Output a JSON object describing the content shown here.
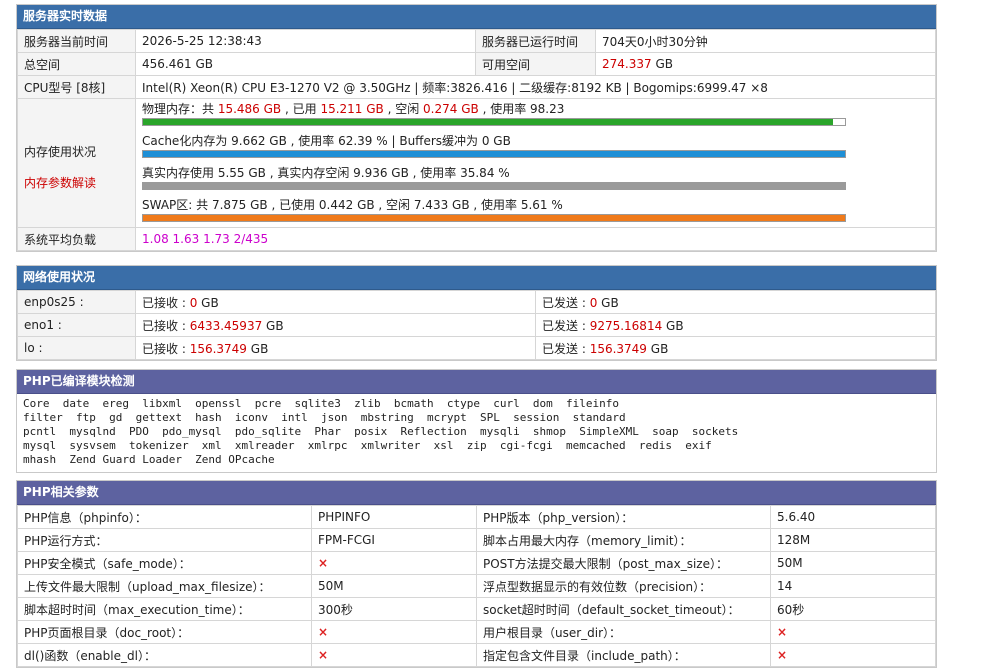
{
  "server": {
    "title": "服务器实时数据",
    "rows": [
      {
        "l1": "服务器当前时间",
        "v1": "2026-5-25 12:38:43",
        "l2": "服务器已运行时间",
        "v2": "704天0小时30分钟"
      },
      {
        "l1": "总空间",
        "v1": "456.461 GB",
        "l2": "可用空间",
        "v2_num": "274.337",
        "v2_unit": " GB"
      }
    ],
    "cpu_label": "CPU型号 [8核]",
    "cpu_value": "Intel(R) Xeon(R) CPU E3-1270 V2 @ 3.50GHz | 频率:3826.416 | 二级缓存:8192 KB | Bogomips:6999.47 ×8",
    "mem_label": "内存使用状况",
    "mem_link": "内存参数解读",
    "mem": {
      "physical": {
        "p1": "物理内存：共 ",
        "total": "15.486 GB",
        "p2": " , 已用 ",
        "used": "15.211 GB",
        "p3": " , 空闲 ",
        "free": "0.274 GB",
        "p4": " , 使用率 98.23",
        "percent": 98.23,
        "color": "#2aa52a"
      },
      "cache": {
        "text": "Cache化内存为 9.662 GB , 使用率 62.39 % | Buffers缓冲为 0 GB",
        "percent": 100,
        "color": "#1e8fd6"
      },
      "real": {
        "text": "真实内存使用 5.55 GB , 真实内存空闲 9.936 GB , 使用率 35.84 %",
        "percent": 100,
        "color": "#9a9a9a"
      },
      "swap": {
        "text": "SWAP区: 共 7.875 GB , 已使用 0.442 GB , 空闲 7.433 GB , 使用率 5.61 %",
        "percent": 100,
        "color": "#f07a1a"
      }
    },
    "load_label": "系统平均负载",
    "load_value": "1.08 1.63 1.73 2/435"
  },
  "network": {
    "title": "网络使用状况",
    "rows": [
      {
        "iface": "enp0s25 :",
        "rx_label": "已接收 : ",
        "rx": "0",
        "rx_unit": " GB",
        "tx_label": "已发送 : ",
        "tx": "0",
        "tx_unit": " GB"
      },
      {
        "iface": "eno1 :",
        "rx_label": "已接收 : ",
        "rx": "6433.45937",
        "rx_unit": " GB",
        "tx_label": "已发送 : ",
        "tx": "9275.16814",
        "tx_unit": " GB"
      },
      {
        "iface": "lo :",
        "rx_label": "已接收 : ",
        "rx": "156.3749",
        "rx_unit": " GB",
        "tx_label": "已发送 : ",
        "tx": "156.3749",
        "tx_unit": " GB"
      }
    ]
  },
  "modules": {
    "title": "PHP已编译模块检测",
    "lines": [
      "Core  date  ereg  libxml  openssl  pcre  sqlite3  zlib  bcmath  ctype  curl  dom  fileinfo",
      "filter  ftp  gd  gettext  hash  iconv  intl  json  mbstring  mcrypt  SPL  session  standard",
      "pcntl  mysqlnd  PDO  pdo_mysql  pdo_sqlite  Phar  posix  Reflection  mysqli  shmop  SimpleXML  soap  sockets",
      "mysql  sysvsem  tokenizer  xml  xmlreader  xmlrpc  xmlwriter  xsl  zip  cgi-fcgi  memcached  redis  exif",
      "mhash  Zend Guard Loader  Zend OPcache"
    ]
  },
  "php": {
    "title": "PHP相关参数",
    "rows": [
      {
        "l1": "PHP信息（phpinfo）：",
        "v1": "PHPINFO",
        "l2": "PHP版本（php_version）：",
        "v2": "5.6.40"
      },
      {
        "l1": "PHP运行方式：",
        "v1": "FPM-FCGI",
        "l2": "脚本占用最大内存（memory_limit）：",
        "v2": "128M"
      },
      {
        "l1": "PHP安全模式（safe_mode）：",
        "v1": "×",
        "l2": "POST方法提交最大限制（post_max_size）：",
        "v2": "50M"
      },
      {
        "l1": "上传文件最大限制（upload_max_filesize）：",
        "v1": "50M",
        "l2": "浮点型数据显示的有效位数（precision）：",
        "v2": "14"
      },
      {
        "l1": "脚本超时时间（max_execution_time）：",
        "v1": "300秒",
        "l2": "socket超时时间（default_socket_timeout）：",
        "v2": "60秒"
      },
      {
        "l1": "PHP页面根目录（doc_root）：",
        "v1": "×",
        "l2": "用户根目录（user_dir）：",
        "v2": "×"
      },
      {
        "l1": "dl()函数（enable_dl）：",
        "v1": "×",
        "l2": "指定包含文件目录（include_path）：",
        "v2": "×"
      }
    ]
  }
}
